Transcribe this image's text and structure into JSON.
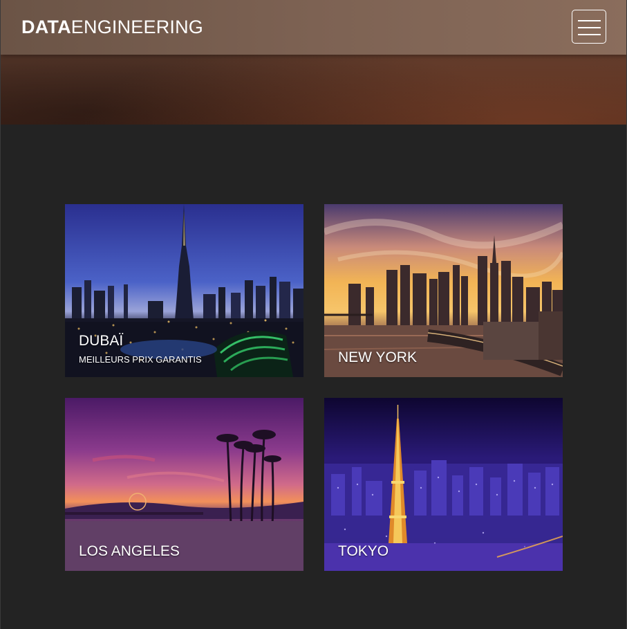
{
  "navbar": {
    "brand_bold": "DATA",
    "brand_light": "ENGINEERING",
    "menu_icon": "hamburger-menu-icon"
  },
  "destinations": [
    {
      "title": "DUBAÏ",
      "subtitle": "MEILLEURS PRIX GARANTIS"
    },
    {
      "title": "NEW YORK",
      "subtitle": ""
    },
    {
      "title": "LOS ANGELES",
      "subtitle": ""
    },
    {
      "title": "TOKYO",
      "subtitle": ""
    }
  ],
  "colors": {
    "page_background": "#232323",
    "text": "#ffffff"
  }
}
